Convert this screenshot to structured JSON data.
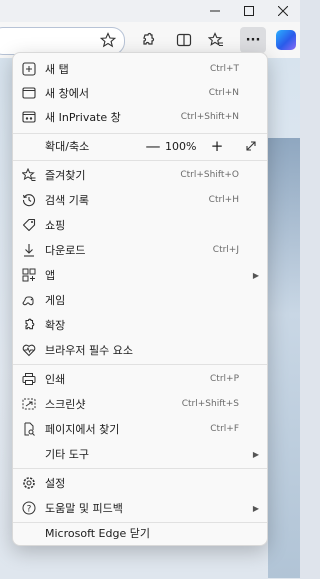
{
  "browser": {
    "window_controls": [
      "minimize",
      "maximize",
      "close"
    ],
    "more_button_label": "···",
    "accent_color": "#2a5bea"
  },
  "menu": {
    "items": [
      {
        "label": "새 탭",
        "shortcut": "Ctrl+T",
        "icon": "new-tab-icon"
      },
      {
        "label": "새 창에서",
        "shortcut": "Ctrl+N",
        "icon": "new-window-icon"
      },
      {
        "label": "새 InPrivate 창",
        "shortcut": "Ctrl+Shift+N",
        "icon": "inprivate-icon"
      },
      {
        "label": "확대/축소",
        "icon": "zoom-row"
      },
      {
        "label": "즐겨찾기",
        "shortcut": "Ctrl+Shift+O",
        "icon": "favorites-icon"
      },
      {
        "label": "검색 기록",
        "shortcut": "Ctrl+H",
        "icon": "history-icon"
      },
      {
        "label": "쇼핑",
        "icon": "shopping-tag-icon"
      },
      {
        "label": "다운로드",
        "shortcut": "Ctrl+J",
        "icon": "download-icon"
      },
      {
        "label": "앱",
        "submenu": true,
        "icon": "apps-icon"
      },
      {
        "label": "게임",
        "icon": "games-icon"
      },
      {
        "label": "확장",
        "icon": "extensions-icon"
      },
      {
        "label": "브라우저 필수 요소",
        "icon": "heart-pulse-icon"
      },
      {
        "label": "인쇄",
        "shortcut": "Ctrl+P",
        "icon": "print-icon"
      },
      {
        "label": "스크린샷",
        "shortcut": "Ctrl+Shift+S",
        "icon": "screenshot-icon"
      },
      {
        "label": "페이지에서 찾기",
        "shortcut": "Ctrl+F",
        "icon": "find-icon"
      },
      {
        "label": "기타 도구",
        "submenu": true
      },
      {
        "label": "설정",
        "icon": "settings-icon"
      },
      {
        "label": "도움말 및 피드백",
        "submenu": true,
        "icon": "help-icon"
      },
      {
        "label": "Microsoft Edge 닫기"
      }
    ],
    "zoom": {
      "minus": "—",
      "value": "100%",
      "plus": "+"
    },
    "submenu_arrow": "▶"
  }
}
